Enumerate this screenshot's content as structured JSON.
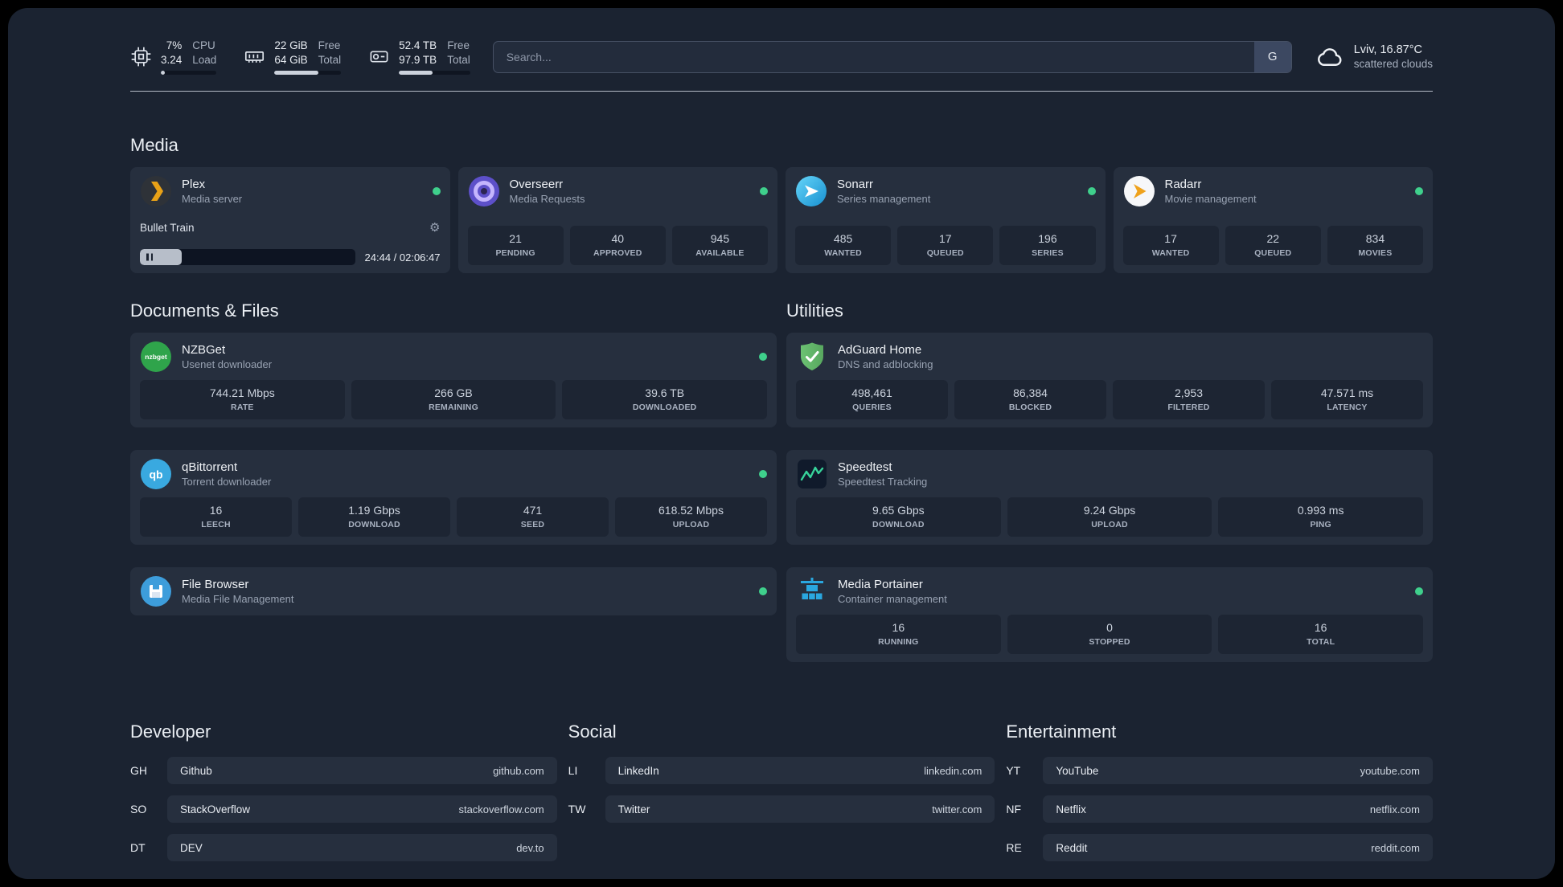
{
  "topbar": {
    "cpu": {
      "value": "7%",
      "sub": "3.24",
      "label1": "CPU",
      "label2": "Load",
      "bar_percent": 7
    },
    "memory": {
      "value": "22 GiB",
      "sub": "64 GiB",
      "label1": "Free",
      "label2": "Total",
      "bar_percent": 66
    },
    "disk": {
      "value": "52.4 TB",
      "sub": "97.9 TB",
      "label1": "Free",
      "label2": "Total",
      "bar_percent": 47
    },
    "search": {
      "placeholder": "Search...",
      "provider_label": "G"
    },
    "weather": {
      "location": "Lviv, 16.87°C",
      "condition": "scattered clouds"
    }
  },
  "sections": {
    "media": {
      "title": "Media",
      "plex": {
        "name": "Plex",
        "desc": "Media server",
        "now_playing": "Bullet Train",
        "time": "24:44 / 02:06:47",
        "progress_percent": 19.5
      },
      "overseerr": {
        "name": "Overseerr",
        "desc": "Media Requests",
        "stats": [
          {
            "value": "21",
            "label": "PENDING"
          },
          {
            "value": "40",
            "label": "APPROVED"
          },
          {
            "value": "945",
            "label": "AVAILABLE"
          }
        ]
      },
      "sonarr": {
        "name": "Sonarr",
        "desc": "Series management",
        "stats": [
          {
            "value": "485",
            "label": "WANTED"
          },
          {
            "value": "17",
            "label": "QUEUED"
          },
          {
            "value": "196",
            "label": "SERIES"
          }
        ]
      },
      "radarr": {
        "name": "Radarr",
        "desc": "Movie management",
        "stats": [
          {
            "value": "17",
            "label": "WANTED"
          },
          {
            "value": "22",
            "label": "QUEUED"
          },
          {
            "value": "834",
            "label": "MOVIES"
          }
        ]
      }
    },
    "documents": {
      "title": "Documents & Files",
      "nzbget": {
        "name": "NZBGet",
        "desc": "Usenet downloader",
        "stats": [
          {
            "value": "744.21 Mbps",
            "label": "RATE"
          },
          {
            "value": "266 GB",
            "label": "REMAINING"
          },
          {
            "value": "39.6 TB",
            "label": "DOWNLOADED"
          }
        ]
      },
      "qbittorrent": {
        "name": "qBittorrent",
        "desc": "Torrent downloader",
        "stats": [
          {
            "value": "16",
            "label": "LEECH"
          },
          {
            "value": "1.19 Gbps",
            "label": "DOWNLOAD"
          },
          {
            "value": "471",
            "label": "SEED"
          },
          {
            "value": "618.52 Mbps",
            "label": "UPLOAD"
          }
        ]
      },
      "filebrowser": {
        "name": "File Browser",
        "desc": "Media File Management"
      }
    },
    "utilities": {
      "title": "Utilities",
      "adguard": {
        "name": "AdGuard Home",
        "desc": "DNS and adblocking",
        "stats": [
          {
            "value": "498,461",
            "label": "QUERIES"
          },
          {
            "value": "86,384",
            "label": "BLOCKED"
          },
          {
            "value": "2,953",
            "label": "FILTERED"
          },
          {
            "value": "47.571 ms",
            "label": "LATENCY"
          }
        ]
      },
      "speedtest": {
        "name": "Speedtest",
        "desc": "Speedtest Tracking",
        "stats": [
          {
            "value": "9.65 Gbps",
            "label": "DOWNLOAD"
          },
          {
            "value": "9.24 Gbps",
            "label": "UPLOAD"
          },
          {
            "value": "0.993 ms",
            "label": "PING"
          }
        ]
      },
      "portainer": {
        "name": "Media Portainer",
        "desc": "Container management",
        "stats": [
          {
            "value": "16",
            "label": "RUNNING"
          },
          {
            "value": "0",
            "label": "STOPPED"
          },
          {
            "value": "16",
            "label": "TOTAL"
          }
        ]
      }
    }
  },
  "bookmarks": [
    {
      "title": "Developer",
      "items": [
        {
          "abbr": "GH",
          "name": "Github",
          "url": "github.com"
        },
        {
          "abbr": "SO",
          "name": "StackOverflow",
          "url": "stackoverflow.com"
        },
        {
          "abbr": "DT",
          "name": "DEV",
          "url": "dev.to"
        }
      ]
    },
    {
      "title": "Social",
      "items": [
        {
          "abbr": "LI",
          "name": "LinkedIn",
          "url": "linkedin.com"
        },
        {
          "abbr": "TW",
          "name": "Twitter",
          "url": "twitter.com"
        }
      ]
    },
    {
      "title": "Entertainment",
      "items": [
        {
          "abbr": "YT",
          "name": "YouTube",
          "url": "youtube.com"
        },
        {
          "abbr": "NF",
          "name": "Netflix",
          "url": "netflix.com"
        },
        {
          "abbr": "RE",
          "name": "Reddit",
          "url": "reddit.com"
        }
      ]
    }
  ],
  "colors": {
    "status_online": "#3fd08c",
    "accent_green": "#37d39a"
  }
}
